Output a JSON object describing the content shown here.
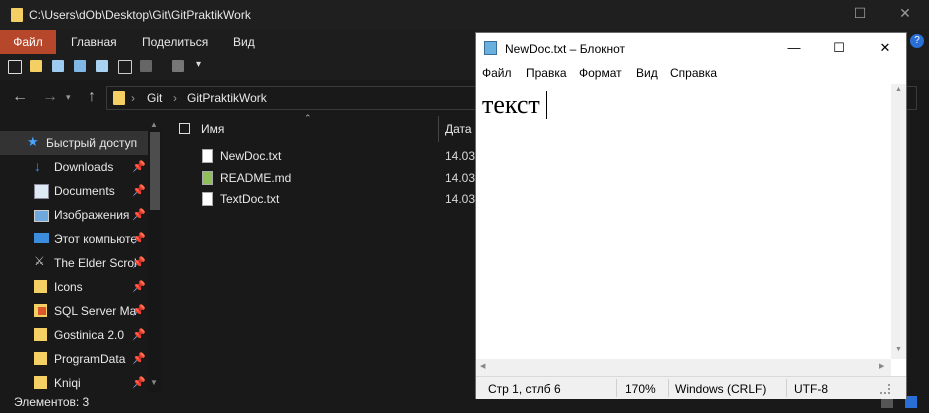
{
  "explorer": {
    "title_path": "C:\\Users\\dOb\\Desktop\\Git\\GitPraktikWork",
    "tabs": [
      "Файл",
      "Главная",
      "Поделиться",
      "Вид"
    ],
    "breadcrumbs": [
      "Git",
      "GitPraktikWork"
    ],
    "column_name": "Имя",
    "column_date": "Дата",
    "sidebar": [
      {
        "label": "Быстрый доступ",
        "icon": "star-icon"
      },
      {
        "label": "Downloads",
        "icon": "download-icon"
      },
      {
        "label": "Documents",
        "icon": "document-icon"
      },
      {
        "label": "Изображения",
        "icon": "pictures-icon"
      },
      {
        "label": "Этот компьютер",
        "icon": "computer-icon"
      },
      {
        "label": "The Elder Scrolls",
        "icon": "game-icon"
      },
      {
        "label": "Icons",
        "icon": "folder-icon"
      },
      {
        "label": "SQL Server Management",
        "icon": "folder-icon"
      },
      {
        "label": "Gostinica 2.0",
        "icon": "folder-icon"
      },
      {
        "label": "ProgramData",
        "icon": "folder-icon"
      },
      {
        "label": "Kniqi",
        "icon": "folder-icon"
      }
    ],
    "files": [
      {
        "name": "NewDoc.txt",
        "date": "14.03."
      },
      {
        "name": "README.md",
        "date": "14.03."
      },
      {
        "name": "TextDoc.txt",
        "date": "14.03."
      }
    ],
    "status": "Элементов: 3",
    "colors": {
      "file_tab": "#b7472a",
      "folder": "#f3cf64",
      "bg": "#191919"
    }
  },
  "notepad": {
    "title": "NewDoc.txt – Блокнот",
    "menu": [
      "Файл",
      "Правка",
      "Формат",
      "Вид",
      "Справка"
    ],
    "content": "текст",
    "status": {
      "position": "Стр 1, стлб 6",
      "zoom": "170%",
      "line_endings": "Windows (CRLF)",
      "encoding": "UTF-8"
    }
  }
}
